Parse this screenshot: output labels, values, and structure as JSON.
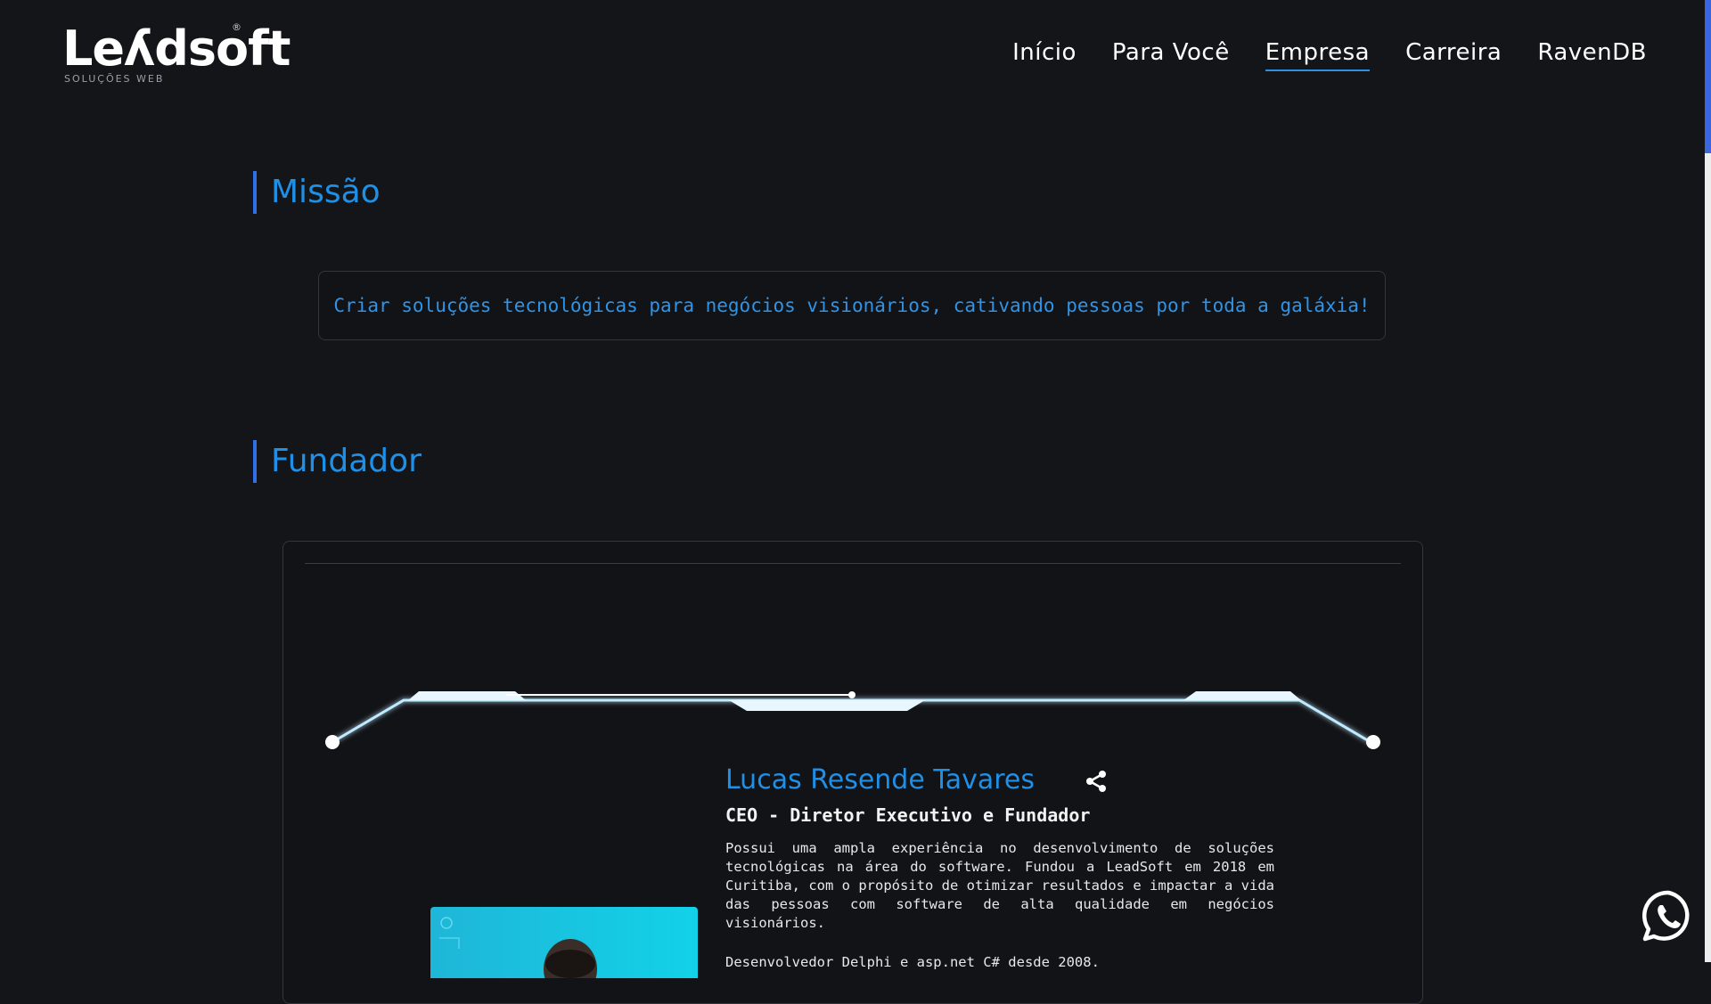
{
  "header": {
    "logo_text": "Leʎdsoft",
    "logo_mark": "®",
    "logo_subtitle": "SOLUÇÕES WEB",
    "nav": [
      {
        "label": "Início",
        "active": false
      },
      {
        "label": "Para Você",
        "active": false
      },
      {
        "label": "Empresa",
        "active": true
      },
      {
        "label": "Carreira",
        "active": false
      },
      {
        "label": "RavenDB",
        "active": false
      }
    ]
  },
  "mission": {
    "title": "Missão",
    "text": "Criar soluções tecnológicas para negócios visionários, cativando pessoas por toda a galáxia!"
  },
  "founder": {
    "section_title": "Fundador",
    "name": "Lucas Resende Tavares",
    "role": "CEO - Diretor Executivo e Fundador",
    "bio": "Possui uma ampla experiência no desenvolvimento de soluções tecnológicas na área do software. Fundou a LeadSoft em 2018 em Curitiba, com o propósito de otimizar resultados e impactar a vida das pessoas com software de alta qualidade em negócios visionários.",
    "bio_more": "Desenvolvedor Delphi e asp.net C# desde 2008."
  },
  "icons": {
    "share": "share-icon",
    "whatsapp": "whatsapp-icon",
    "photo": "founder-photo"
  },
  "colors": {
    "background": "#141519",
    "accent": "#1e90e8",
    "title_bar": "#2f6fe8",
    "scroll_thumb": "#3a66e0"
  }
}
